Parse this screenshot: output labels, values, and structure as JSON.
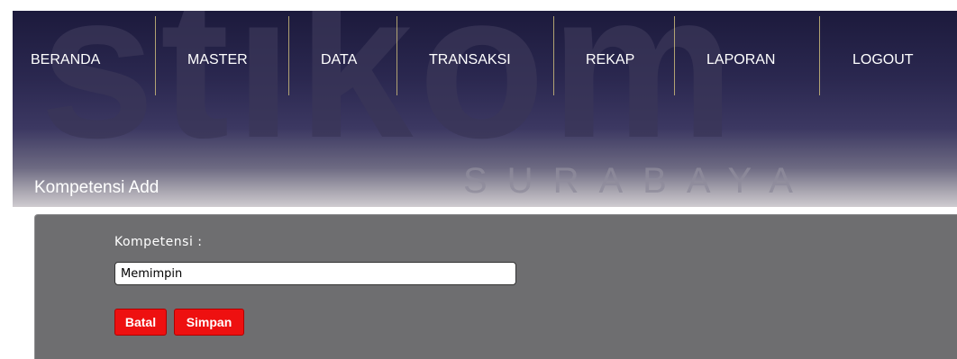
{
  "nav": {
    "items": [
      {
        "label": "BERANDA"
      },
      {
        "label": "MASTER"
      },
      {
        "label": "DATA"
      },
      {
        "label": "TRANSAKSI"
      },
      {
        "label": "REKAP"
      },
      {
        "label": "LAPORAN"
      },
      {
        "label": "LOGOUT"
      }
    ]
  },
  "page": {
    "title": "Kompetensi Add"
  },
  "watermark": {
    "text": "stikom",
    "subtext": "SURABAYA"
  },
  "form": {
    "label": "Kompetensi :",
    "value": "Memimpin",
    "cancel_label": "Batal",
    "save_label": "Simpan"
  },
  "colors": {
    "header_dark": "#1c1a3c",
    "panel": "#6e6e70",
    "button_red": "#ee1010",
    "separator": "#c9b87a"
  }
}
